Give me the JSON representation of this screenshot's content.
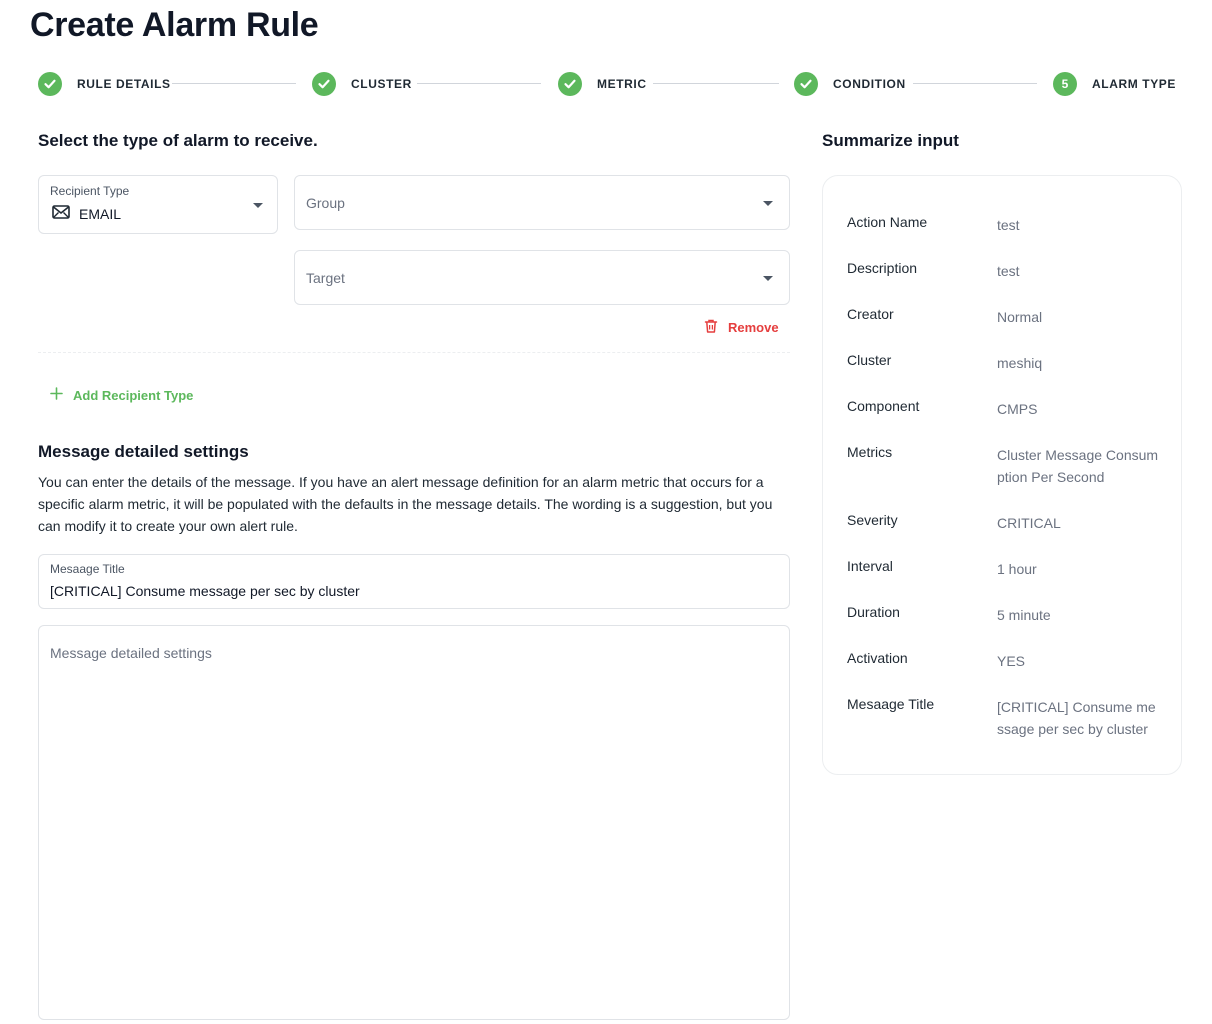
{
  "page": {
    "title": "Create Alarm Rule"
  },
  "stepper": {
    "steps": [
      {
        "label": "RULE DETAILS",
        "status": "done"
      },
      {
        "label": "CLUSTER",
        "status": "done"
      },
      {
        "label": "METRIC",
        "status": "done"
      },
      {
        "label": "CONDITION",
        "status": "done"
      },
      {
        "label": "ALARM TYPE",
        "status": "current",
        "number": "5"
      }
    ],
    "accent_color": "#5cb85c"
  },
  "alarm": {
    "section_title": "Select the type of alarm to receive.",
    "recipient_type": {
      "label": "Recipient Type",
      "value": "EMAIL",
      "icon": "mail-icon"
    },
    "group": {
      "placeholder": "Group"
    },
    "target": {
      "placeholder": "Target"
    },
    "remove_label": "Remove",
    "add_label": "Add Recipient Type",
    "danger_color": "#e53e3e"
  },
  "message": {
    "heading": "Message detailed settings",
    "description": "You can enter the details of the message. If you have an alert message definition for an alarm metric that occurs for a specific alarm metric, it will be populated with the defaults in the message details. The wording is a suggestion, but you can modify it to create your own alert rule.",
    "title_field": {
      "label": "Mesaage Title",
      "value": "[CRITICAL] Consume message per sec by cluster"
    },
    "body_placeholder": "Message detailed settings"
  },
  "summary": {
    "title": "Summarize input",
    "rows": [
      {
        "key": "Action Name",
        "value": "test"
      },
      {
        "key": "Description",
        "value": "test"
      },
      {
        "key": "Creator",
        "value": "Normal"
      },
      {
        "key": "Cluster",
        "value": "meshiq"
      },
      {
        "key": "Component",
        "value": "CMPS"
      },
      {
        "key": "Metrics",
        "value": "Cluster Message Consumption Per Second"
      },
      {
        "key": "Severity",
        "value": "CRITICAL"
      },
      {
        "key": "Interval",
        "value": "1 hour"
      },
      {
        "key": "Duration",
        "value": "5 minute"
      },
      {
        "key": "Activation",
        "value": "YES"
      },
      {
        "key": "Mesaage Title",
        "value": "[CRITICAL] Consume message per sec by cluster"
      }
    ]
  }
}
